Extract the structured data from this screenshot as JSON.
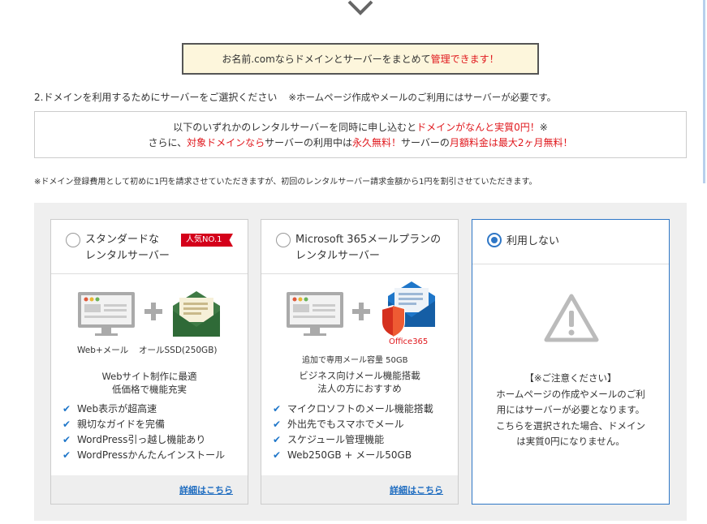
{
  "banner": {
    "text_main": "お名前.comならドメインとサーバーをまとめて",
    "text_highlight": "管理できます！"
  },
  "step": {
    "label": "2.ドメインを利用するためにサーバーをご選択ください",
    "note": "※ホームページ作成やメールのご利用にはサーバーが必要です。"
  },
  "promo": {
    "line1_a": "以下のいずれかのレンタルサーバーを同時に申し込むと",
    "line1_b": "ドメインがなんと実質0円！",
    "line1_c": "※",
    "line2_a": "さらに、",
    "line2_b": "対象ドメインなら",
    "line2_c": "サーバーの利用中は",
    "line2_d": "永久無料！",
    "line2_e": "サーバーの",
    "line2_f": "月額料金は最大2ヶ月無料！"
  },
  "fine_print": "※ドメイン登録費用として初めに1円を請求させていただきますが、初回のレンタルサーバー請求金額から1円を割引させていただきます。",
  "cards": [
    {
      "title_line1": "スタンダードな",
      "title_line2": "レンタルサーバー",
      "badge": "人気NO.1",
      "caption_left": "Web+メール",
      "caption_right": "オールSSD(250GB)",
      "desc_line1": "Webサイト制作に最適",
      "desc_line2": "低価格で機能充実",
      "features": [
        "Web表示が超高速",
        "親切なガイドを完備",
        "WordPress引っ越し機能あり",
        "WordPressかんたんインストール"
      ],
      "link": "詳細はこちら",
      "selected": false
    },
    {
      "title_line1": "Microsoft 365メールプランの",
      "title_line2": "レンタルサーバー",
      "office_label": "Office365",
      "caption": "追加で専用メール容量 50GB",
      "desc_line1": "ビジネス向けメール機能搭載",
      "desc_line2": "法人の方におすすめ",
      "features": [
        "マイクロソフトのメール機能搭載",
        "外出先でもスマホでメール",
        "スケジュール管理機能",
        "Web250GB + メール50GB"
      ],
      "link": "詳細はこちら",
      "selected": false
    },
    {
      "title": "利用しない",
      "caution_title": "【※ご注意ください】",
      "caution_lines": [
        "ホームページの作成やメールのご利",
        "用にはサーバーが必要となります。",
        "こちらを選択された場合、ドメイン",
        "は実質0円になりません。"
      ],
      "selected": true
    }
  ],
  "colors": {
    "accent_blue": "#2f77c6",
    "red": "#e0181d",
    "badge_red": "#d4001a",
    "banner_bg": "#fdf6dc",
    "mail_green": "#3f7a45"
  },
  "icons": [
    "chevron-down-icon",
    "monitor-icon",
    "plus-icon",
    "envelope-icon",
    "shield-icon",
    "warning-icon",
    "check-icon"
  ]
}
